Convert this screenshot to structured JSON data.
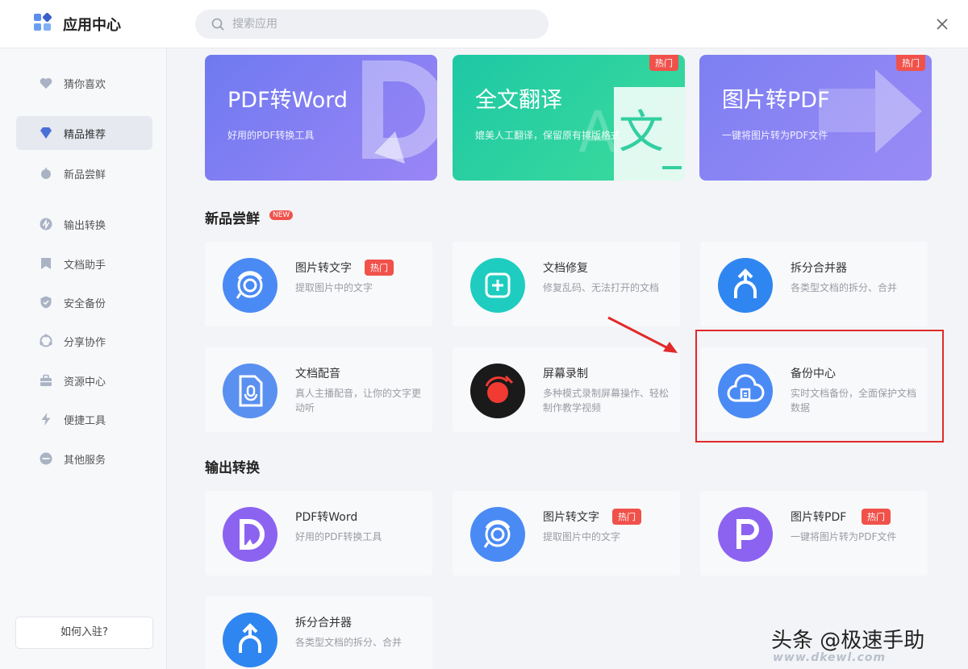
{
  "header": {
    "title": "应用中心",
    "search_placeholder": "搜索应用"
  },
  "sidebar": {
    "items": [
      {
        "label": "猜你喜欢",
        "icon": "heart-icon",
        "active": false
      },
      {
        "label": "精品推荐",
        "icon": "diamond-icon",
        "active": true
      },
      {
        "label": "新品尝鲜",
        "icon": "apple-icon",
        "active": false
      },
      {
        "label": "输出转换",
        "icon": "convert-icon",
        "active": false
      },
      {
        "label": "文档助手",
        "icon": "document-icon",
        "active": false
      },
      {
        "label": "安全备份",
        "icon": "shield-icon",
        "active": false
      },
      {
        "label": "分享协作",
        "icon": "share-icon",
        "active": false
      },
      {
        "label": "资源中心",
        "icon": "briefcase-icon",
        "active": false
      },
      {
        "label": "便捷工具",
        "icon": "lightning-icon",
        "active": false
      },
      {
        "label": "其他服务",
        "icon": "minus-circle-icon",
        "active": false
      }
    ],
    "join_label": "如何入驻?"
  },
  "banners": [
    {
      "title": "PDF转Word",
      "desc": "好用的PDF转换工具",
      "hot": ""
    },
    {
      "title": "全文翻译",
      "desc": "媲美人工翻译，保留原有排版格式",
      "hot": "热门"
    },
    {
      "title": "图片转PDF",
      "desc": "一键将图片转为PDF文件",
      "hot": "热门"
    }
  ],
  "sections": {
    "new": {
      "title": "新品尝鲜",
      "badge": "NEW"
    },
    "output": {
      "title": "输出转换"
    }
  },
  "cards": [
    {
      "title": "图片转文字",
      "desc": "提取图片中的文字",
      "hot": "热门",
      "icon": "ocr-icon"
    },
    {
      "title": "文档修复",
      "desc": "修复乱码、无法打开的文档",
      "hot": "",
      "icon": "repair-icon"
    },
    {
      "title": "拆分合并器",
      "desc": "各类型文档的拆分、合并",
      "hot": "",
      "icon": "split-merge-icon"
    },
    {
      "title": "文档配音",
      "desc": "真人主播配音，让你的文字更动听",
      "hot": "",
      "icon": "voice-icon"
    },
    {
      "title": "屏幕录制",
      "desc": "多种模式录制屏幕操作、轻松制作教学视频",
      "hot": "",
      "icon": "record-icon"
    },
    {
      "title": "备份中心",
      "desc": "实时文档备份，全面保护文档数据",
      "hot": "",
      "icon": "cloud-backup-icon"
    },
    {
      "title": "PDF转Word",
      "desc": "好用的PDF转换工具",
      "hot": "",
      "icon": "pdf-word-icon"
    },
    {
      "title": "图片转文字",
      "desc": "提取图片中的文字",
      "hot": "热门",
      "icon": "ocr-icon"
    },
    {
      "title": "图片转PDF",
      "desc": "一键将图片转为PDF文件",
      "hot": "热门",
      "icon": "image-pdf-icon"
    },
    {
      "title": "拆分合并器",
      "desc": "各类型文档的拆分、合并",
      "hot": "",
      "icon": "split-merge-icon"
    }
  ],
  "watermark": {
    "text": "头条 @极速手助",
    "site": "www.dkewl.com"
  },
  "colors": {
    "accent_blue": "#4a8af4",
    "hot_red": "#f0524b",
    "highlight_red": "#e12a2a"
  }
}
